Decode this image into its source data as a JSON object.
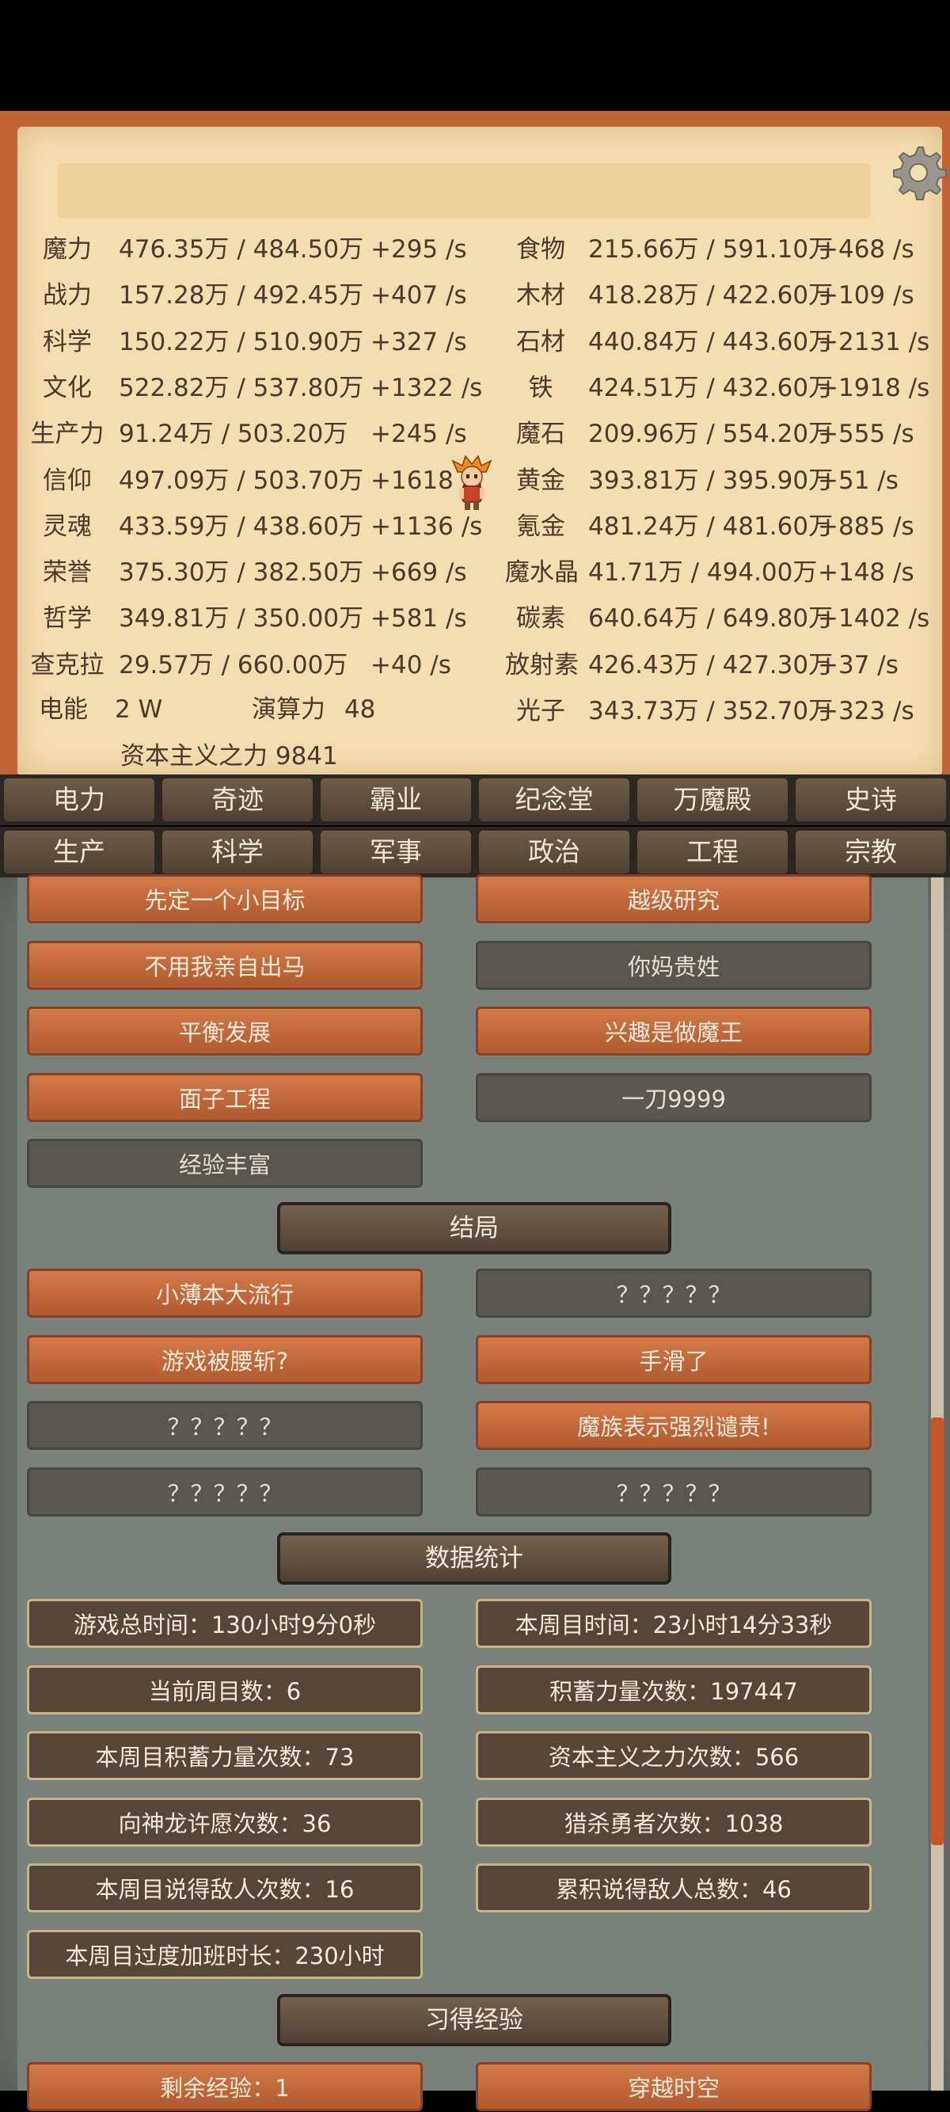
{
  "resources_left": [
    {
      "name": "魔力",
      "amount": "476.35万 / 484.50万",
      "rate": "+295 /s"
    },
    {
      "name": "战力",
      "amount": "157.28万 / 492.45万",
      "rate": "+407 /s"
    },
    {
      "name": "科学",
      "amount": "150.22万 / 510.90万",
      "rate": "+327 /s"
    },
    {
      "name": "文化",
      "amount": "522.82万 / 537.80万",
      "rate": "+1322 /s"
    },
    {
      "name": "生产力",
      "amount": "91.24万 / 503.20万",
      "rate": "+245 /s"
    },
    {
      "name": "信仰",
      "amount": "497.09万 / 503.70万",
      "rate": "+1618 /s"
    },
    {
      "name": "灵魂",
      "amount": "433.59万 / 438.60万",
      "rate": "+1136 /s"
    },
    {
      "name": "荣誉",
      "amount": "375.30万 / 382.50万",
      "rate": "+669 /s"
    },
    {
      "name": "哲学",
      "amount": "349.81万 / 350.00万",
      "rate": "+581 /s"
    },
    {
      "name": "查克拉",
      "amount": "29.57万 / 660.00万",
      "rate": "+40 /s"
    }
  ],
  "resources_right": [
    {
      "name": "食物",
      "amount": "215.66万 / 591.10万",
      "rate": "+468 /s"
    },
    {
      "name": "木材",
      "amount": "418.28万 / 422.60万",
      "rate": "+109 /s"
    },
    {
      "name": "石材",
      "amount": "440.84万 / 443.60万",
      "rate": "+2131 /s"
    },
    {
      "name": "铁",
      "amount": "424.51万 / 432.60万",
      "rate": "+1918 /s"
    },
    {
      "name": "魔石",
      "amount": "209.96万 / 554.20万",
      "rate": "+555 /s"
    },
    {
      "name": "黄金",
      "amount": "393.81万 / 395.90万",
      "rate": "+51 /s"
    },
    {
      "name": "氪金",
      "amount": "481.24万 / 481.60万",
      "rate": "+885 /s"
    },
    {
      "name": "魔水晶",
      "amount": "41.71万 / 494.00万",
      "rate": "+148 /s"
    },
    {
      "name": "碳素",
      "amount": "640.64万 / 649.80万",
      "rate": "+1402 /s"
    },
    {
      "name": "放射素",
      "amount": "426.43万 / 427.30万",
      "rate": "+37 /s"
    },
    {
      "name": "光子",
      "amount": "343.73万 / 352.70万",
      "rate": "+323 /s"
    }
  ],
  "misc": {
    "power_label": "电能",
    "power_value": "2 W",
    "compute_label": "演算力",
    "compute_value": "48",
    "capitalism": "资本主义之力 9841"
  },
  "tabs_row1": [
    "电力",
    "奇迹",
    "霸业",
    "纪念堂",
    "万魔殿",
    "史诗"
  ],
  "tabs_row2": [
    "生产",
    "科学",
    "军事",
    "政治",
    "工程",
    "宗教"
  ],
  "achievements_top": [
    {
      "left": "先定一个小目标",
      "right": "越级研究"
    },
    {
      "left": "不用我亲自出马",
      "right": "你妈贵姓"
    },
    {
      "left": "平衡发展",
      "right": "兴趣是做魔王"
    },
    {
      "left": "面子工程",
      "right": "一刀9999"
    },
    {
      "left": "经验丰富",
      "right": ""
    }
  ],
  "section_ending": "结局",
  "endings": [
    {
      "left": "小薄本大流行",
      "right": "？？？？？"
    },
    {
      "left": "游戏被腰斩?",
      "right": "手滑了"
    },
    {
      "left": "？？？？？",
      "right": "魔族表示强烈谴责!"
    },
    {
      "left": "？？？？？",
      "right": "？？？？？"
    }
  ],
  "section_stats": "数据统计",
  "stats": [
    "游戏总时间：130小时9分0秒",
    "本周目时间：23小时14分33秒",
    "当前周目数：6",
    "积蓄力量次数：197447",
    "本周目积蓄力量次数：73",
    "资本主义之力次数：566",
    "向神龙许愿次数：36",
    "猎杀勇者次数：1038",
    "本周目说得敌人次数：16",
    "累积说得敌人总数：46",
    "本周目过度加班时长：230小时"
  ],
  "section_exp": "习得经验",
  "exp_partial": [
    "剩余经验：1",
    "穿越时空"
  ]
}
